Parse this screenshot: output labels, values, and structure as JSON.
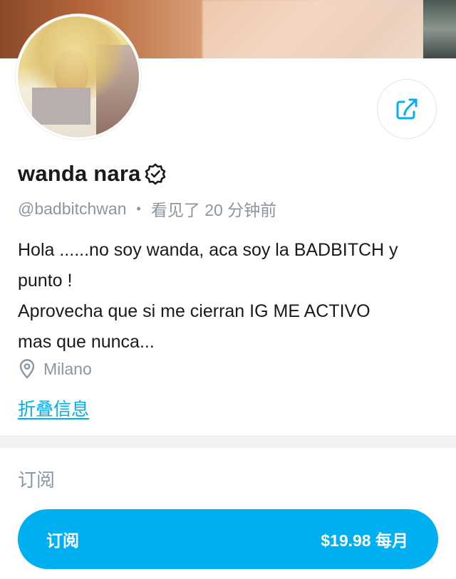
{
  "profile": {
    "name": "wanda nara",
    "handle": "@badbitchwan",
    "last_seen": "看见了 20 分钟前",
    "bio_lines": [
      "Hola ......no soy wanda, aca soy la BADBITCH y",
      "punto !",
      "Aprovecha que si me cierran IG ME ACTIVO",
      "mas que nunca..."
    ],
    "location": "Milano",
    "collapse_label": "折叠信息"
  },
  "subscription": {
    "section_title": "订阅",
    "button_label": "订阅",
    "price": "$19.98 每月"
  },
  "colors": {
    "accent": "#00aff0",
    "muted": "#8a96a3"
  },
  "icons": {
    "share": "share-icon",
    "verified": "verified-badge-icon",
    "location": "location-pin-icon"
  }
}
